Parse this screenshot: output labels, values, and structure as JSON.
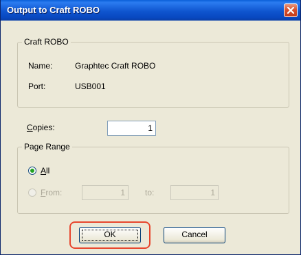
{
  "window": {
    "title": "Output to Craft ROBO"
  },
  "device_group": {
    "label": "Craft ROBO",
    "name_label": "Name:",
    "name_value": "Graphtec Craft ROBO",
    "port_label": "Port:",
    "port_value": "USB001"
  },
  "copies": {
    "label": "Copies:",
    "value": "1"
  },
  "page_range": {
    "label": "Page Range",
    "all_label": "All",
    "all_selected": true,
    "from_label": "From:",
    "from_value": "1",
    "to_label": "to:",
    "to_value": "1"
  },
  "buttons": {
    "ok_label": "OK",
    "cancel_label": "Cancel"
  },
  "colors": {
    "title_bar": "#0a55cf",
    "dialog_bg": "#ece9d8",
    "highlight": "#e8452c"
  }
}
